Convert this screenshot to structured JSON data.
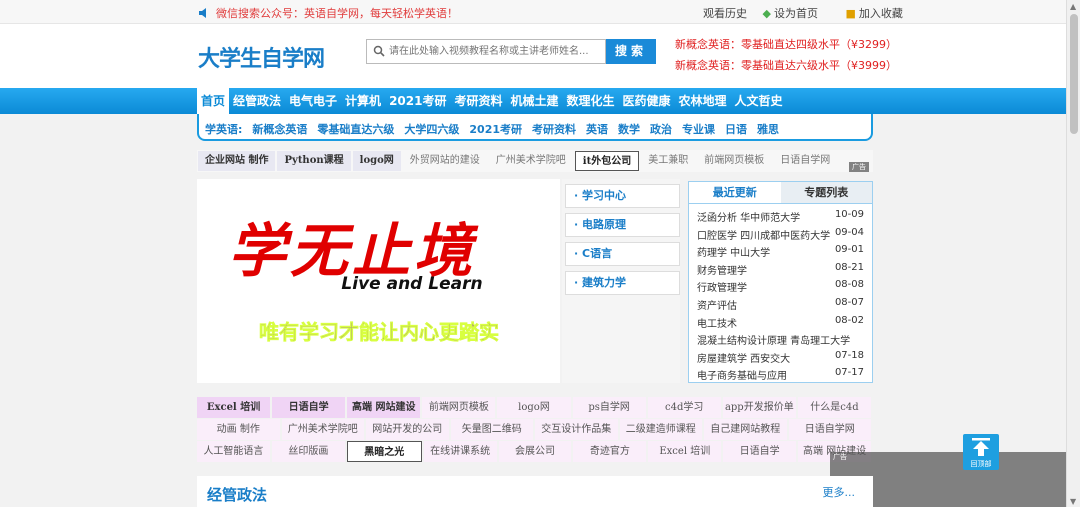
{
  "topbar": {
    "notice": "微信搜索公众号：英语自学网，每天轻松学英语！",
    "history": "观看历史",
    "homepage": "设为首页",
    "favorite": "加入收藏"
  },
  "header": {
    "logo": "大学生自学网",
    "search_placeholder": "请在此处输入视频教程名称或主讲老师姓名...",
    "search_button": "搜索",
    "promo1_prefix": "新概念英语：",
    "promo1_text": "零基础直达四级水平（¥3299）",
    "promo2_prefix": "新概念英语：",
    "promo2_text": "零基础直达六级水平（¥3999）"
  },
  "nav": [
    "首页",
    "经管政法",
    "电气电子",
    "计算机",
    "2021考研",
    "考研资料",
    "机械土建",
    "数理化生",
    "医药健康",
    "农林地理",
    "人文哲史"
  ],
  "subnav": [
    "学英语:",
    "新概念英语",
    "零基础直达六级",
    "大学四六级",
    "2021考研",
    "考研资料",
    "英语",
    "数学",
    "政治",
    "专业课",
    "日语",
    "雅思"
  ],
  "adrow1": [
    {
      "label": "企业网站 制作",
      "style": "b"
    },
    {
      "label": "Python课程",
      "style": "b"
    },
    {
      "label": "logo网",
      "style": "b"
    },
    {
      "label": "外贸网站的建设",
      "style": "g"
    },
    {
      "label": "广州美术学院吧",
      "style": "g"
    },
    {
      "label": "it外包公司",
      "style": "w"
    },
    {
      "label": "美工兼职",
      "style": "g"
    },
    {
      "label": "前端网页模板",
      "style": "g"
    },
    {
      "label": "日语自学网",
      "style": "g"
    }
  ],
  "ad_badge": "广告",
  "banner": {
    "big": "学无止境",
    "en": "Live and Learn",
    "slogan": "唯有学习才能让内心更踏实"
  },
  "menu": [
    "· 学习中心",
    "· 电路原理",
    "· C语言",
    "· 建筑力学"
  ],
  "news": {
    "tab_recent": "最近更新",
    "tab_topics": "专题列表",
    "items": [
      {
        "title": "泛函分析 华中师范大学",
        "date": "10-09"
      },
      {
        "title": "口腔医学 四川成都中医药大学",
        "date": "09-04"
      },
      {
        "title": "药理学 中山大学",
        "date": "09-01"
      },
      {
        "title": "财务管理学",
        "date": "08-21"
      },
      {
        "title": "行政管理学",
        "date": "08-08"
      },
      {
        "title": "资产评估",
        "date": "08-07"
      },
      {
        "title": "电工技术",
        "date": "08-02"
      },
      {
        "title": "混凝土结构设计原理 青岛理工大学",
        "date": ""
      },
      {
        "title": "房屋建筑学 西安交大",
        "date": "07-18"
      },
      {
        "title": "电子商务基础与应用",
        "date": "07-17"
      }
    ]
  },
  "grid": [
    [
      {
        "t": "Excel 培训",
        "s": "p"
      },
      {
        "t": "日语自学",
        "s": "p"
      },
      {
        "t": "高端 网站建设",
        "s": "p"
      },
      {
        "t": "前端网页模板",
        "s": "l"
      },
      {
        "t": "logo网",
        "s": "l"
      },
      {
        "t": "ps自学网",
        "s": "l"
      },
      {
        "t": "c4d学习",
        "s": "l"
      },
      {
        "t": "app开发报价单",
        "s": "l"
      },
      {
        "t": "什么是c4d",
        "s": "l"
      }
    ],
    [
      {
        "t": "动画 制作",
        "s": "l"
      },
      {
        "t": "广州美术学院吧",
        "s": "l"
      },
      {
        "t": "网站开发的公司",
        "s": "l"
      },
      {
        "t": "矢量图二维码",
        "s": "l"
      },
      {
        "t": "交互设计作品集",
        "s": "l"
      },
      {
        "t": "二级建造师课程",
        "s": "l"
      },
      {
        "t": "自己建网站教程",
        "s": "l"
      },
      {
        "t": "日语自学网",
        "s": "l"
      }
    ],
    [
      {
        "t": "人工智能语言",
        "s": "l"
      },
      {
        "t": "丝印版画",
        "s": "l"
      },
      {
        "t": "黑暗之光",
        "s": "wb"
      },
      {
        "t": "在线讲课系统",
        "s": "l"
      },
      {
        "t": "会展公司",
        "s": "l"
      },
      {
        "t": "奇迹官方",
        "s": "l"
      },
      {
        "t": "Excel 培训",
        "s": "l"
      },
      {
        "t": "日语自学",
        "s": "l"
      },
      {
        "t": "高端 网站建设",
        "s": "l"
      }
    ]
  ],
  "section": {
    "title": "经管政法",
    "more": "更多..."
  },
  "backtop": "回顶部",
  "colors": {
    "accent": "#1a8ad8",
    "nav": "#0b8ad6",
    "red": "#e02020"
  }
}
